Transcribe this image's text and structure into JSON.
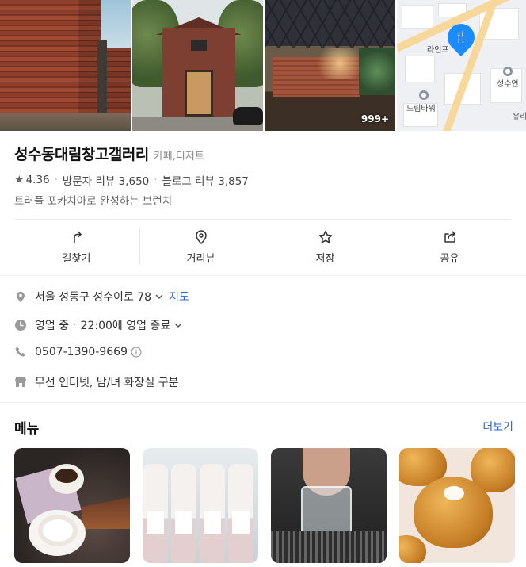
{
  "place": {
    "name": "성수동대림창고갤러리",
    "category": "카페,디저트",
    "rating": "4.36",
    "visitor_reviews": "방문자 리뷰 3,650",
    "blog_reviews": "블로그 리뷰 3,857",
    "description": "트러플 포카치아로 완성하는 브런치"
  },
  "photos": {
    "count_badge": "999+"
  },
  "map_preview": {
    "labels": [
      "라인프",
      "성수연",
      "드림타워",
      "유리"
    ]
  },
  "actions": [
    {
      "label": "길찾기",
      "icon": "directions-icon"
    },
    {
      "label": "거리뷰",
      "icon": "location-pin-icon"
    },
    {
      "label": "저장",
      "icon": "star-icon"
    },
    {
      "label": "공유",
      "icon": "share-icon"
    }
  ],
  "details": {
    "address": "서울 성동구 성수이로 78",
    "map_link": "지도",
    "hours_status": "영업 중",
    "hours_close": "22:00에 영업 종료",
    "phone": "0507-1390-9669",
    "amenities": "무선 인터넷, 남/녀 화장실 구분"
  },
  "menu": {
    "title": "메뉴",
    "more": "더보기"
  },
  "colors": {
    "link": "#2a62d8",
    "map_pin": "#1a8cff"
  }
}
